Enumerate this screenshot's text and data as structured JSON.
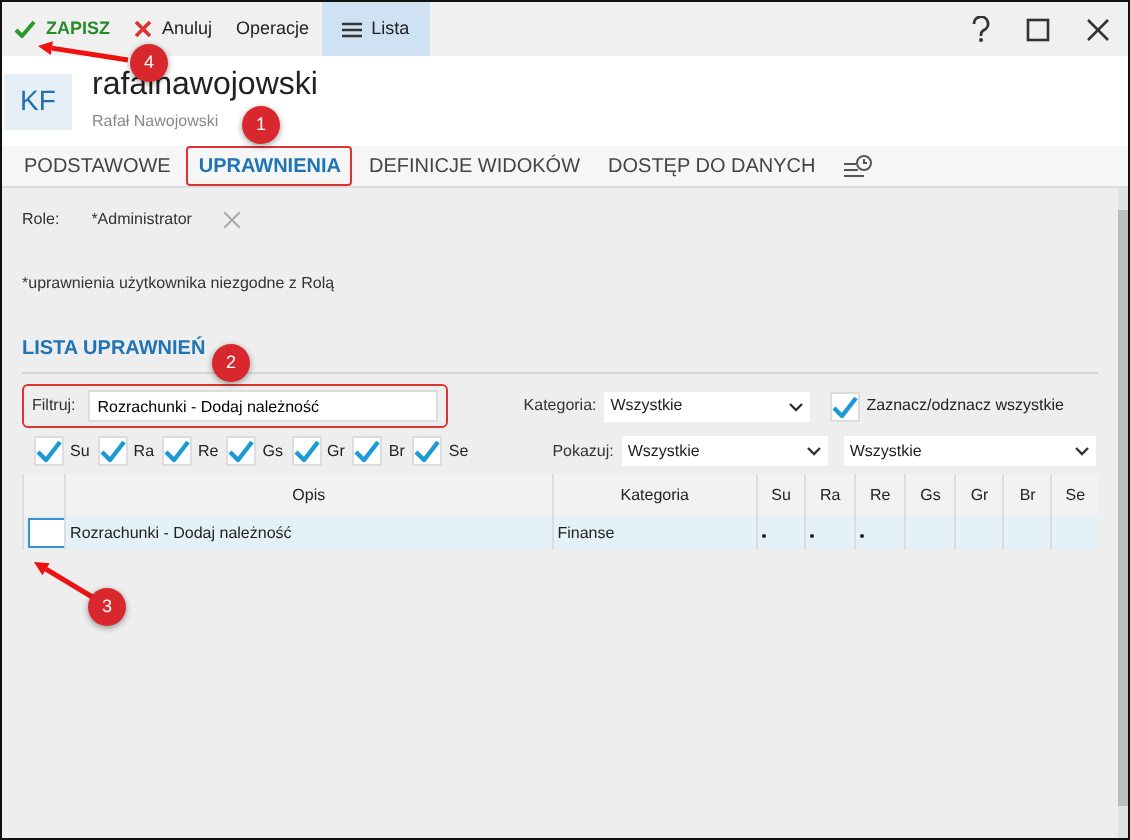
{
  "toolbar": [
    {
      "label": "ZAPISZ",
      "kind": "save",
      "selected": false
    },
    {
      "label": "Anuluj",
      "kind": "cancel",
      "selected": false
    },
    {
      "label": "Operacje",
      "kind": "plain",
      "selected": false
    },
    {
      "label": "Lista",
      "kind": "list",
      "selected": true
    }
  ],
  "user": {
    "initials": "KF",
    "login": "rafalnawojowski",
    "full_name": "Rafał Nawojowski"
  },
  "tabs": [
    {
      "label": "PODSTAWOWE",
      "selected": false,
      "highlighted": false
    },
    {
      "label": "UPRAWNIENIA",
      "selected": true,
      "highlighted": true
    },
    {
      "label": "DEFINICJE WIDOKÓW",
      "selected": false,
      "highlighted": false
    },
    {
      "label": "DOSTĘP DO DANYCH",
      "selected": false,
      "highlighted": false
    }
  ],
  "role": {
    "label": "Role:",
    "value": "*Administrator"
  },
  "note": "*uprawnienia użytkownika niezgodne z Rolą",
  "section_title": "LISTA UPRAWNIEŃ",
  "filter": {
    "label": "Filtruj:",
    "value": "Rozrachunki - Dodaj należność",
    "highlighted": true
  },
  "category": {
    "label": "Kategoria:",
    "value": "Wszystkie"
  },
  "select_all": {
    "label": "Zaznacz/odznacz wszystkie",
    "checked": true
  },
  "column_toggles": [
    {
      "label": "Su",
      "checked": true
    },
    {
      "label": "Ra",
      "checked": true
    },
    {
      "label": "Re",
      "checked": true
    },
    {
      "label": "Gs",
      "checked": true
    },
    {
      "label": "Gr",
      "checked": true
    },
    {
      "label": "Br",
      "checked": true
    },
    {
      "label": "Se",
      "checked": true
    }
  ],
  "show": {
    "label": "Pokazuj:",
    "value": "Wszystkie",
    "second_value": "Wszystkie"
  },
  "table": {
    "columns": [
      "Opis",
      "Kategoria",
      "Su",
      "Ra",
      "Re",
      "Gs",
      "Gr",
      "Br",
      "Se"
    ],
    "rows": [
      {
        "checked": false,
        "selected": true,
        "highlighted": true,
        "description": "Rozrachunki - Dodaj należność",
        "category": "Finanse",
        "flags": [
          true,
          true,
          true,
          false,
          false,
          false,
          false
        ]
      }
    ]
  },
  "callouts": [
    {
      "number": "4"
    },
    {
      "number": "1"
    },
    {
      "number": "2"
    },
    {
      "number": "3"
    }
  ]
}
